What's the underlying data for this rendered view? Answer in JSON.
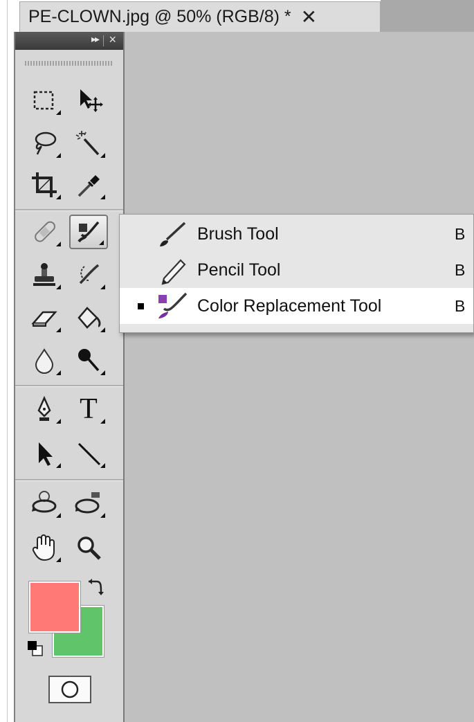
{
  "document_tab": {
    "title": "PE-CLOWN.jpg @ 50% (RGB/8) *",
    "close_glyph": "✕"
  },
  "toolbox": {
    "header": {
      "collapse_glyph": "▸▸",
      "close_glyph": "×"
    },
    "tools": [
      {
        "name": "rectangular-marquee-tool",
        "icon": "marquee-icon"
      },
      {
        "name": "move-tool",
        "icon": "move-icon"
      },
      {
        "name": "lasso-tool",
        "icon": "lasso-icon"
      },
      {
        "name": "magic-wand-tool",
        "icon": "magic-wand-icon"
      },
      {
        "name": "crop-tool",
        "icon": "crop-icon"
      },
      {
        "name": "eyedropper-tool",
        "icon": "eyedropper-icon"
      },
      {
        "name": "spot-healing-brush-tool",
        "icon": "bandage-icon"
      },
      {
        "name": "color-replacement-tool",
        "icon": "color-replacement-icon",
        "active": true
      },
      {
        "name": "clone-stamp-tool",
        "icon": "stamp-icon"
      },
      {
        "name": "history-brush-tool",
        "icon": "history-brush-icon"
      },
      {
        "name": "eraser-tool",
        "icon": "eraser-icon"
      },
      {
        "name": "paint-bucket-tool",
        "icon": "paint-bucket-icon"
      },
      {
        "name": "blur-tool",
        "icon": "drop-icon"
      },
      {
        "name": "dodge-tool",
        "icon": "dodge-icon"
      },
      {
        "name": "pen-tool",
        "icon": "pen-icon"
      },
      {
        "name": "type-tool",
        "icon": "type-icon",
        "label": "T"
      },
      {
        "name": "path-selection-tool",
        "icon": "arrow-icon"
      },
      {
        "name": "line-tool",
        "icon": "line-icon"
      },
      {
        "name": "3d-rotate-tool",
        "icon": "3d-rotate-icon"
      },
      {
        "name": "3d-orbit-tool",
        "icon": "3d-orbit-icon"
      },
      {
        "name": "hand-tool",
        "icon": "hand-icon"
      },
      {
        "name": "zoom-tool",
        "icon": "zoom-icon"
      }
    ],
    "colors": {
      "foreground": "#ff7a77",
      "background": "#5fc46a"
    }
  },
  "flyout_menu": {
    "items": [
      {
        "label": "Brush Tool",
        "shortcut": "B",
        "icon": "brush-icon",
        "selected": false
      },
      {
        "label": "Pencil Tool",
        "shortcut": "B",
        "icon": "pencil-icon",
        "selected": false
      },
      {
        "label": "Color Replacement Tool",
        "shortcut": "B",
        "icon": "color-replacement-icon",
        "selected": true
      }
    ]
  },
  "colors": {
    "canvas": "#c0c0c0",
    "toolbox": "#d7d7d7",
    "menu": "#e6e6e6",
    "selected_item": "#ffffff"
  }
}
